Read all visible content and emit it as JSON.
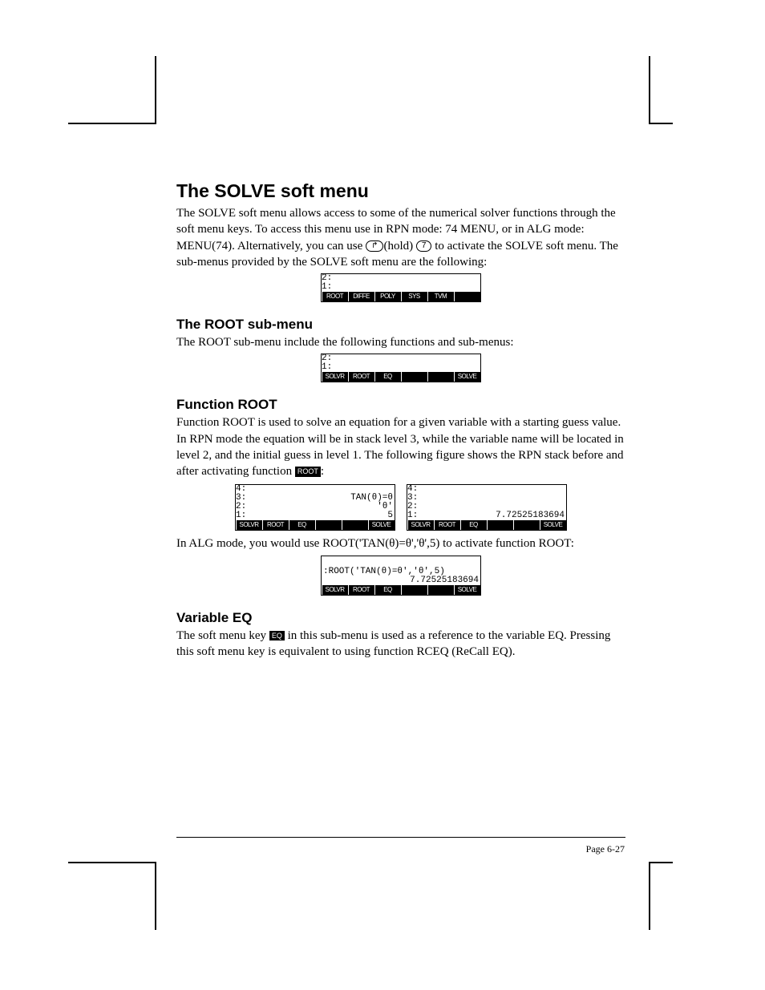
{
  "headings": {
    "h1": "The SOLVE soft menu",
    "h2_root": "The ROOT sub-menu",
    "h2_func": "Function ROOT",
    "h2_var": "Variable EQ"
  },
  "paragraphs": {
    "p1a": "The SOLVE soft menu allows access to some of the numerical solver functions through the soft menu keys.  To access this menu use in RPN mode: 74 MENU, or in ALG mode: MENU(74).  Alternatively, you can use ",
    "p1b": "(hold) ",
    "p1c": " to activate the SOLVE soft menu.   The sub-menus provided by the SOLVE soft menu are the following:",
    "p2": "The ROOT sub-menu include the following functions and sub-menus:",
    "p3a": "Function ROOT is used to solve an equation for a given variable with a starting guess value.  In RPN mode the equation will be in stack level 3, while the variable name will be located in level 2, and the initial guess in level 1.  The following figure shows the RPN stack before and after activating function ",
    "p3b": ":",
    "p4": "In ALG mode, you would use ROOT('TAN(θ)=θ','θ',5) to activate function ROOT:",
    "p5a": "The soft menu key ",
    "p5b": " in this sub-menu is used as a reference to the variable EQ.   Pressing this soft menu key is equivalent to using function RCEQ (ReCall EQ)."
  },
  "keys": {
    "shift": "↱",
    "seven": "7"
  },
  "labels": {
    "root": "ROOT",
    "eq": "EQ"
  },
  "lcd1": {
    "rows": [
      "2:",
      "1:"
    ],
    "softkeys": [
      "ROOT",
      "DIFFE",
      "POLY",
      "SYS",
      "TVM",
      ""
    ]
  },
  "lcd2": {
    "rows": [
      "2:",
      "1:"
    ],
    "softkeys": [
      "SOLVR",
      "ROOT",
      "EQ",
      "",
      "",
      "SOLVE"
    ]
  },
  "lcd3a": {
    "rows": [
      {
        "l": "4:",
        "v": ""
      },
      {
        "l": "3:",
        "v": "TAN(θ)=θ"
      },
      {
        "l": "2:",
        "v": "'θ'"
      },
      {
        "l": "1:",
        "v": "5"
      }
    ],
    "softkeys": [
      "SOLVR",
      "ROOT",
      "EQ",
      "",
      "",
      "SOLVE"
    ]
  },
  "lcd3b": {
    "rows": [
      {
        "l": "4:",
        "v": ""
      },
      {
        "l": "3:",
        "v": ""
      },
      {
        "l": "2:",
        "v": ""
      },
      {
        "l": "1:",
        "v": "7.72525183694"
      }
    ],
    "softkeys": [
      "SOLVR",
      "ROOT",
      "EQ",
      "",
      "",
      "SOLVE"
    ]
  },
  "lcd4": {
    "line1": ":ROOT('TAN(θ)=θ','θ',5)",
    "line2": "7.72525183694",
    "softkeys": [
      "SOLVR",
      "ROOT",
      "EQ",
      "",
      "",
      "SOLVE"
    ]
  },
  "page": "Page 6-27"
}
